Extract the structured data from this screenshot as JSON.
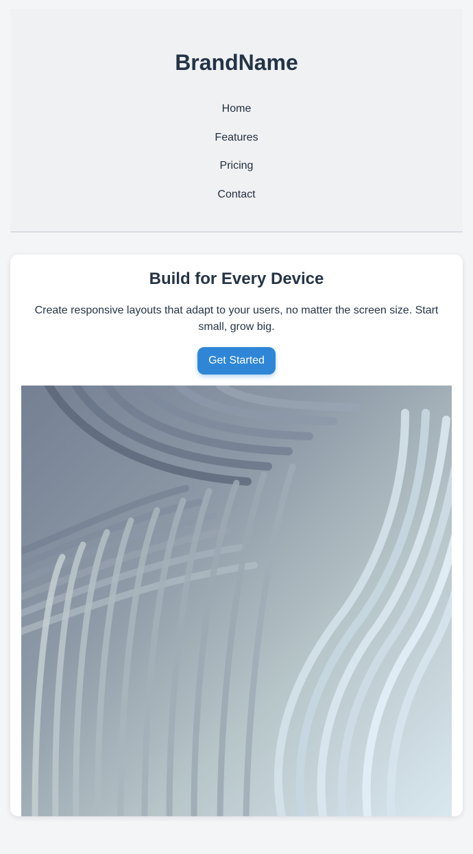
{
  "header": {
    "brand": "BrandName",
    "nav": [
      {
        "label": "Home"
      },
      {
        "label": "Features"
      },
      {
        "label": "Pricing"
      },
      {
        "label": "Contact"
      }
    ]
  },
  "hero": {
    "title": "Build for Every Device",
    "text": "Create responsive layouts that adapt to your users, no matter the screen size. Start small, grow big.",
    "cta_label": "Get Started",
    "image": "abstract wavy white ribbons"
  }
}
